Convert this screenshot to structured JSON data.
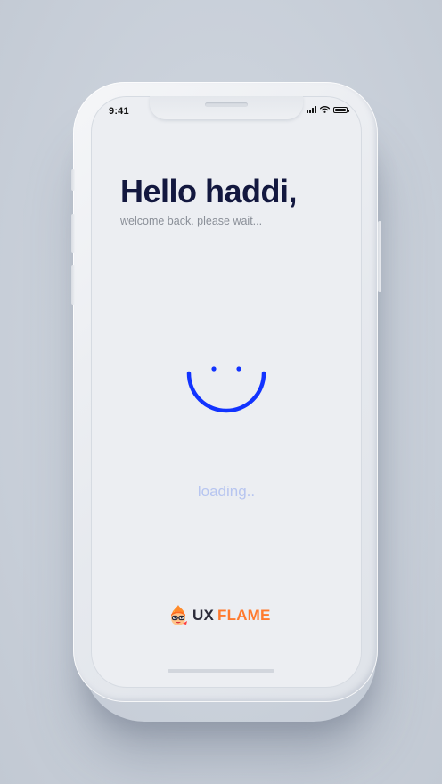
{
  "status_bar": {
    "time": "9:41",
    "signal_icon": "cellular-signal-icon",
    "wifi_icon": "wifi-icon",
    "battery_icon": "battery-full-icon"
  },
  "main": {
    "greeting": "Hello haddi,",
    "subtitle": "welcome back. please wait...",
    "loading_label": "loading..",
    "smiley_icon": "smiley-loading-icon"
  },
  "brand": {
    "logo_icon": "ux-flame-mascot-icon",
    "name_part1": "UX",
    "name_part2": "FLAME"
  },
  "colors": {
    "accent": "#1233ff",
    "heading": "#13183f",
    "subtle_text": "#8a8f98",
    "loading_text": "#b7c5f0",
    "brand_orange": "#ff7a2e",
    "screen_bg": "#eceef2"
  }
}
